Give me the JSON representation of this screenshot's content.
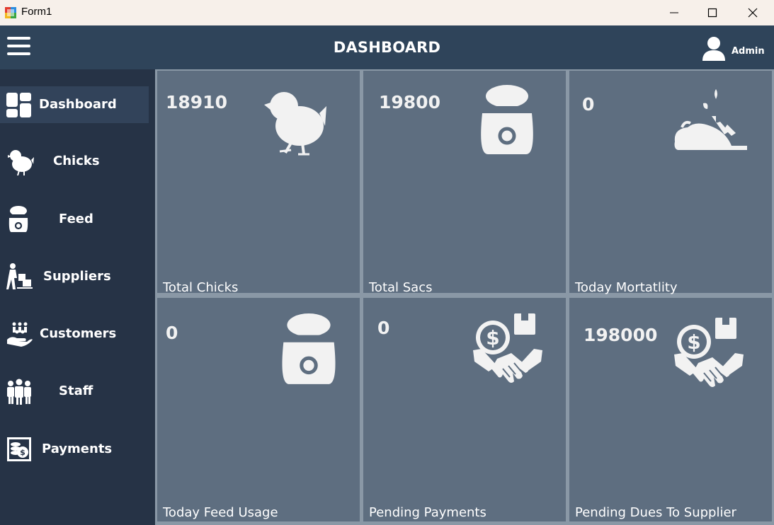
{
  "window": {
    "title": "Form1",
    "minimize": "minimize",
    "maximize": "maximize",
    "close": "close"
  },
  "header": {
    "title": "DASHBOARD",
    "user": "Admin"
  },
  "sidebar": {
    "items": [
      {
        "label": "Dashboard",
        "icon": "dashboard-grid-icon",
        "active": true
      },
      {
        "label": "Chicks",
        "icon": "chick-icon"
      },
      {
        "label": "Feed",
        "icon": "feed-sack-icon"
      },
      {
        "label": "Suppliers",
        "icon": "supplier-cart-icon"
      },
      {
        "label": "Customers",
        "icon": "customers-hand-icon"
      },
      {
        "label": "Staff",
        "icon": "staff-group-icon"
      },
      {
        "label": "Payments",
        "icon": "coins-payment-icon"
      }
    ]
  },
  "cards": [
    {
      "value": "18910",
      "label": "Total Chicks",
      "icon": "chick-icon"
    },
    {
      "value": "19800",
      "label": "Total Sacs",
      "icon": "feed-sack-icon"
    },
    {
      "value": "0",
      "label": "Today Mortatlity",
      "icon": "dead-bird-icon"
    },
    {
      "value": "0",
      "label": "Today Feed Usage",
      "icon": "feed-sack-icon"
    },
    {
      "value": "0",
      "label": "Pending Payments",
      "icon": "handshake-money-icon"
    },
    {
      "value": "198000",
      "label": "Pending Dues To Supplier",
      "icon": "handshake-money-icon"
    }
  ],
  "colors": {
    "header": "#2f445a",
    "sidebar": "#263346",
    "card": "#5e6e80",
    "grid_gap": "#8a98a6"
  }
}
